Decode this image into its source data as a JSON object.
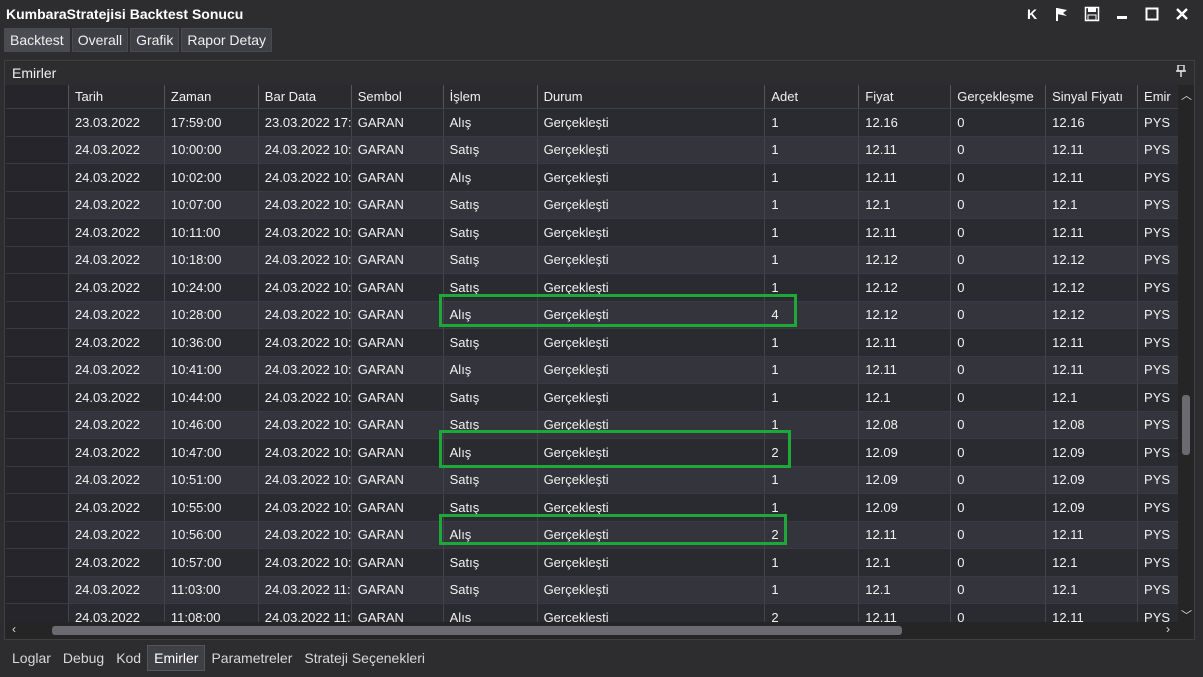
{
  "window": {
    "title": "KumbaraStratejisi Backtest Sonucu",
    "k_label": "K"
  },
  "top_tabs": [
    {
      "label": "Backtest"
    },
    {
      "label": "Overall"
    },
    {
      "label": "Grafik"
    },
    {
      "label": "Rapor Detay"
    }
  ],
  "panel": {
    "title": "Emirler"
  },
  "grid": {
    "columns": [
      "",
      "Tarih",
      "Zaman",
      "Bar Data",
      "Sembol",
      "İşlem",
      "Durum",
      "Adet",
      "Fiyat",
      "Gerçekleşme",
      "Sinyal Fiyatı",
      "Emir"
    ],
    "rows": [
      [
        "",
        "23.03.2022",
        "17:59:00",
        "23.03.2022 17:",
        "GARAN",
        "Alış",
        "Gerçekleşti",
        "1",
        "12.16",
        "0",
        "12.16",
        "PYS"
      ],
      [
        "",
        "24.03.2022",
        "10:00:00",
        "24.03.2022 10:",
        "GARAN",
        "Satış",
        "Gerçekleşti",
        "1",
        "12.11",
        "0",
        "12.11",
        "PYS"
      ],
      [
        "",
        "24.03.2022",
        "10:02:00",
        "24.03.2022 10:",
        "GARAN",
        "Alış",
        "Gerçekleşti",
        "1",
        "12.11",
        "0",
        "12.11",
        "PYS"
      ],
      [
        "",
        "24.03.2022",
        "10:07:00",
        "24.03.2022 10:",
        "GARAN",
        "Satış",
        "Gerçekleşti",
        "1",
        "12.1",
        "0",
        "12.1",
        "PYS"
      ],
      [
        "",
        "24.03.2022",
        "10:11:00",
        "24.03.2022 10:",
        "GARAN",
        "Satış",
        "Gerçekleşti",
        "1",
        "12.11",
        "0",
        "12.11",
        "PYS"
      ],
      [
        "",
        "24.03.2022",
        "10:18:00",
        "24.03.2022 10:",
        "GARAN",
        "Satış",
        "Gerçekleşti",
        "1",
        "12.12",
        "0",
        "12.12",
        "PYS"
      ],
      [
        "",
        "24.03.2022",
        "10:24:00",
        "24.03.2022 10:",
        "GARAN",
        "Satış",
        "Gerçekleşti",
        "1",
        "12.12",
        "0",
        "12.12",
        "PYS"
      ],
      [
        "",
        "24.03.2022",
        "10:28:00",
        "24.03.2022 10:",
        "GARAN",
        "Alış",
        "Gerçekleşti",
        "4",
        "12.12",
        "0",
        "12.12",
        "PYS"
      ],
      [
        "",
        "24.03.2022",
        "10:36:00",
        "24.03.2022 10:",
        "GARAN",
        "Satış",
        "Gerçekleşti",
        "1",
        "12.11",
        "0",
        "12.11",
        "PYS"
      ],
      [
        "",
        "24.03.2022",
        "10:41:00",
        "24.03.2022 10:",
        "GARAN",
        "Alış",
        "Gerçekleşti",
        "1",
        "12.11",
        "0",
        "12.11",
        "PYS"
      ],
      [
        "",
        "24.03.2022",
        "10:44:00",
        "24.03.2022 10:",
        "GARAN",
        "Satış",
        "Gerçekleşti",
        "1",
        "12.1",
        "0",
        "12.1",
        "PYS"
      ],
      [
        "",
        "24.03.2022",
        "10:46:00",
        "24.03.2022 10:",
        "GARAN",
        "Satış",
        "Gerçekleşti",
        "1",
        "12.08",
        "0",
        "12.08",
        "PYS"
      ],
      [
        "",
        "24.03.2022",
        "10:47:00",
        "24.03.2022 10:",
        "GARAN",
        "Alış",
        "Gerçekleşti",
        "2",
        "12.09",
        "0",
        "12.09",
        "PYS"
      ],
      [
        "",
        "24.03.2022",
        "10:51:00",
        "24.03.2022 10:",
        "GARAN",
        "Satış",
        "Gerçekleşti",
        "1",
        "12.09",
        "0",
        "12.09",
        "PYS"
      ],
      [
        "",
        "24.03.2022",
        "10:55:00",
        "24.03.2022 10:",
        "GARAN",
        "Satış",
        "Gerçekleşti",
        "1",
        "12.09",
        "0",
        "12.09",
        "PYS"
      ],
      [
        "",
        "24.03.2022",
        "10:56:00",
        "24.03.2022 10:",
        "GARAN",
        "Alış",
        "Gerçekleşti",
        "2",
        "12.11",
        "0",
        "12.11",
        "PYS"
      ],
      [
        "",
        "24.03.2022",
        "10:57:00",
        "24.03.2022 10:",
        "GARAN",
        "Satış",
        "Gerçekleşti",
        "1",
        "12.1",
        "0",
        "12.1",
        "PYS"
      ],
      [
        "",
        "24.03.2022",
        "11:03:00",
        "24.03.2022 11:",
        "GARAN",
        "Satış",
        "Gerçekleşti",
        "1",
        "12.1",
        "0",
        "12.1",
        "PYS"
      ],
      [
        "",
        "24.03.2022",
        "11:08:00",
        "24.03.2022 11:",
        "GARAN",
        "Alış",
        "Gerçekleşti",
        "2",
        "12.11",
        "0",
        "12.11",
        "PYS"
      ]
    ]
  },
  "highlight_color": "#1fa83a",
  "bottom_tabs": [
    {
      "label": "Loglar"
    },
    {
      "label": "Debug"
    },
    {
      "label": "Kod"
    },
    {
      "label": "Emirler"
    },
    {
      "label": "Parametreler"
    },
    {
      "label": "Strateji Seçenekleri"
    }
  ]
}
